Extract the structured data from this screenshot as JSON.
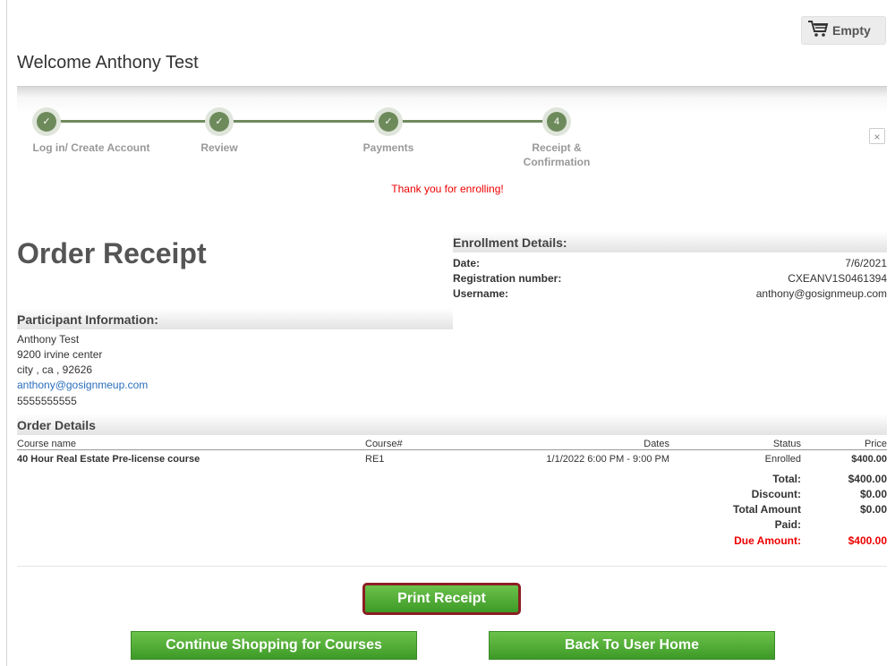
{
  "cart": {
    "label": "Empty",
    "icon": "cart-icon"
  },
  "welcome": "Welcome Anthony Test",
  "steps": [
    {
      "label": "Log in/ Create Account",
      "mark": "✓"
    },
    {
      "label": "Review",
      "mark": "✓"
    },
    {
      "label": "Payments",
      "mark": "✓"
    },
    {
      "label_line1": "Receipt &",
      "label_line2": "Confirmation",
      "mark": "4"
    }
  ],
  "close_icon": "×",
  "thanks": "Thank you for enrolling!",
  "order_title": "Order Receipt",
  "enrollment": {
    "heading": "Enrollment Details:",
    "date_label": "Date:",
    "date_value": "7/6/2021",
    "reg_label": "Registration number:",
    "reg_value": "CXEANV1S0461394",
    "user_label": "Username:",
    "user_value": "anthony@gosignmeup.com"
  },
  "participant": {
    "heading": "Participant Information:",
    "name": "Anthony Test",
    "address1": "9200 irvine center",
    "address2": "city , ca , 92626",
    "email": "anthony@gosignmeup.com",
    "phone": "5555555555"
  },
  "order_details": {
    "heading": "Order Details",
    "columns": {
      "course_name": "Course name",
      "course_num": "Course#",
      "dates": "Dates",
      "status": "Status",
      "price": "Price"
    },
    "rows": [
      {
        "course_name": "40 Hour Real Estate Pre-license course",
        "course_num": "RE1",
        "dates": "1/1/2022 6:00 PM - 9:00 PM",
        "status": "Enrolled",
        "price": "$400.00"
      }
    ],
    "totals": {
      "total_label": "Total:",
      "total_value": "$400.00",
      "discount_label": "Discount:",
      "discount_value": "$0.00",
      "total_amount_label": "Total Amount",
      "total_amount_value": "$0.00",
      "paid_label": "Paid:",
      "due_label": "Due Amount:",
      "due_value": "$400.00"
    }
  },
  "buttons": {
    "print": "Print Receipt",
    "continue": "Continue Shopping for Courses",
    "home": "Back To User Home"
  },
  "colors": {
    "accent_green": "#4fab35",
    "step_green": "#6d8a5b",
    "due_red": "#e00000",
    "print_border": "#8b1e24"
  }
}
